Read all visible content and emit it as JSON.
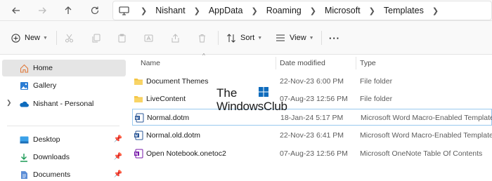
{
  "address_bar": {
    "breadcrumbs": [
      "Nishant",
      "AppData",
      "Roaming",
      "Microsoft",
      "Templates"
    ]
  },
  "toolbar": {
    "new_label": "New",
    "sort_label": "Sort",
    "view_label": "View",
    "more_label": "···"
  },
  "sidebar": {
    "items": [
      {
        "label": "Home"
      },
      {
        "label": "Gallery"
      },
      {
        "label": "Nishant - Personal"
      },
      {
        "label": "Desktop"
      },
      {
        "label": "Downloads"
      },
      {
        "label": "Documents"
      }
    ]
  },
  "columns": {
    "name": "Name",
    "date": "Date modified",
    "type": "Type"
  },
  "files": [
    {
      "name": "Document Themes",
      "date": "22-Nov-23 6:00 PM",
      "type": "File folder",
      "icon": "folder-icon"
    },
    {
      "name": "LiveContent",
      "date": "07-Aug-23 12:56 PM",
      "type": "File folder",
      "icon": "folder-icon"
    },
    {
      "name": "Normal.dotm",
      "date": "18-Jan-24 5:17 PM",
      "type": "Microsoft Word Macro-Enabled Template",
      "icon": "word-template-icon"
    },
    {
      "name": "Normal.old.dotm",
      "date": "22-Nov-23 6:41 PM",
      "type": "Microsoft Word Macro-Enabled Template",
      "icon": "word-template-icon"
    },
    {
      "name": "Open Notebook.onetoc2",
      "date": "07-Aug-23 12:56 PM",
      "type": "Microsoft OneNote Table Of Contents",
      "icon": "onenote-icon"
    }
  ],
  "watermark": {
    "line1": "The",
    "line2": "WindowsClub"
  },
  "colors": {
    "folder": "#f4c542",
    "word": "#2b5797",
    "onenote": "#7719aa",
    "home": "#e07a3d",
    "accent_blue": "#0f6cbd"
  }
}
